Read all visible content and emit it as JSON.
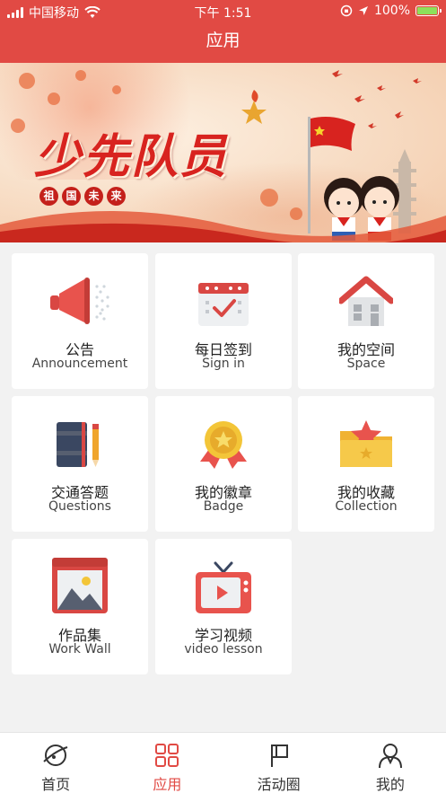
{
  "status_bar": {
    "carrier": "中国移动",
    "time": "下午 1:51",
    "battery": "100%"
  },
  "header": {
    "title": "应用"
  },
  "banner": {
    "title": "少先队员",
    "subtitle_chars": [
      "祖",
      "国",
      "未",
      "来"
    ]
  },
  "apps": [
    {
      "cn": "公告",
      "en": "Announcement",
      "icon": "megaphone-icon"
    },
    {
      "cn": "每日签到",
      "en": "Sign in",
      "icon": "calendar-check-icon"
    },
    {
      "cn": "我的空间",
      "en": "Space",
      "icon": "house-icon"
    },
    {
      "cn": "交通答题",
      "en": "Questions",
      "icon": "notebook-pencil-icon"
    },
    {
      "cn": "我的徽章",
      "en": "Badge",
      "icon": "medal-icon"
    },
    {
      "cn": "我的收藏",
      "en": "Collection",
      "icon": "folder-star-icon"
    },
    {
      "cn": "作品集",
      "en": "Work Wall",
      "icon": "image-folder-icon"
    },
    {
      "cn": "学习视频",
      "en": "video lesson",
      "icon": "tv-play-icon"
    }
  ],
  "tabs": [
    {
      "label": "首页",
      "icon": "planet-icon"
    },
    {
      "label": "应用",
      "icon": "grid-icon"
    },
    {
      "label": "活动圈",
      "icon": "flag-icon"
    },
    {
      "label": "我的",
      "icon": "user-icon"
    }
  ],
  "colors": {
    "primary": "#e14a44",
    "background": "#f2f2f2",
    "battery": "#8de05a"
  },
  "active_tab": 1
}
